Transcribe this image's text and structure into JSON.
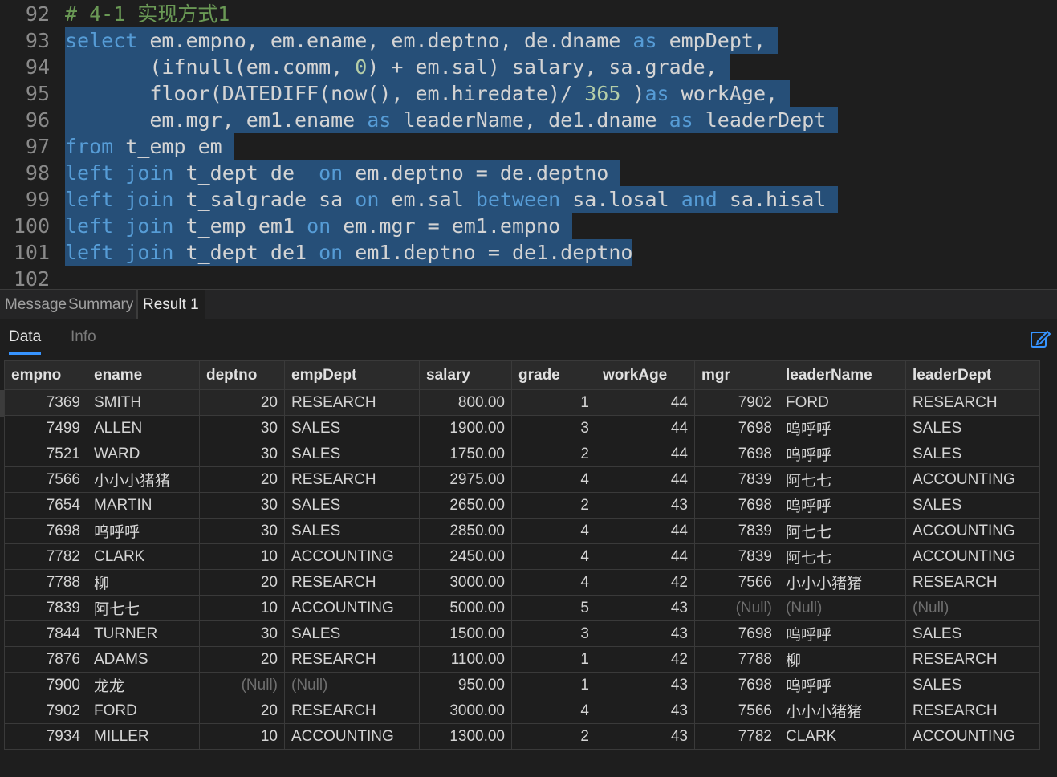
{
  "editor": {
    "lines": [
      {
        "num": "92",
        "highlight": false,
        "tokens": [
          {
            "t": "# 4-1 实现方式1",
            "c": "cmt"
          }
        ]
      },
      {
        "num": "93",
        "highlight": true,
        "tokens": [
          {
            "t": "select",
            "c": "kw"
          },
          {
            "t": " em.empno, em.ename, em.deptno, de.dname ",
            "c": "txt"
          },
          {
            "t": "as",
            "c": "kw"
          },
          {
            "t": " empDept, ",
            "c": "txt"
          }
        ]
      },
      {
        "num": "94",
        "highlight": true,
        "tokens": [
          {
            "t": "       (ifnull(em.comm, ",
            "c": "txt"
          },
          {
            "t": "0",
            "c": "num"
          },
          {
            "t": ") + em.sal) salary, sa.grade, ",
            "c": "txt"
          }
        ]
      },
      {
        "num": "95",
        "highlight": true,
        "tokens": [
          {
            "t": "       floor(DATEDIFF(now(), em.hiredate)/ ",
            "c": "txt"
          },
          {
            "t": "365",
            "c": "num"
          },
          {
            "t": " )",
            "c": "txt"
          },
          {
            "t": "as",
            "c": "kw"
          },
          {
            "t": " workAge, ",
            "c": "txt"
          }
        ]
      },
      {
        "num": "96",
        "highlight": true,
        "tokens": [
          {
            "t": "       em.mgr, em1.ename ",
            "c": "txt"
          },
          {
            "t": "as",
            "c": "kw"
          },
          {
            "t": " leaderName, de1.dname ",
            "c": "txt"
          },
          {
            "t": "as",
            "c": "kw"
          },
          {
            "t": " leaderDept ",
            "c": "txt"
          }
        ]
      },
      {
        "num": "97",
        "highlight": true,
        "tokens": [
          {
            "t": "from",
            "c": "kw"
          },
          {
            "t": " t_emp em ",
            "c": "txt"
          }
        ]
      },
      {
        "num": "98",
        "highlight": true,
        "tokens": [
          {
            "t": "left",
            "c": "kw"
          },
          {
            "t": " ",
            "c": "txt"
          },
          {
            "t": "join",
            "c": "kw"
          },
          {
            "t": " t_dept de  ",
            "c": "txt"
          },
          {
            "t": "on",
            "c": "kw"
          },
          {
            "t": " em.deptno = de.deptno ",
            "c": "txt"
          }
        ]
      },
      {
        "num": "99",
        "highlight": true,
        "tokens": [
          {
            "t": "left",
            "c": "kw"
          },
          {
            "t": " ",
            "c": "txt"
          },
          {
            "t": "join",
            "c": "kw"
          },
          {
            "t": " t_salgrade sa ",
            "c": "txt"
          },
          {
            "t": "on",
            "c": "kw"
          },
          {
            "t": " em.sal ",
            "c": "txt"
          },
          {
            "t": "between",
            "c": "kw"
          },
          {
            "t": " sa.losal ",
            "c": "txt"
          },
          {
            "t": "and",
            "c": "kw"
          },
          {
            "t": " sa.hisal ",
            "c": "txt"
          }
        ]
      },
      {
        "num": "100",
        "highlight": true,
        "tokens": [
          {
            "t": "left",
            "c": "kw"
          },
          {
            "t": " ",
            "c": "txt"
          },
          {
            "t": "join",
            "c": "kw"
          },
          {
            "t": " t_emp em1 ",
            "c": "txt"
          },
          {
            "t": "on",
            "c": "kw"
          },
          {
            "t": " em.mgr = em1.empno ",
            "c": "txt"
          }
        ]
      },
      {
        "num": "101",
        "highlight": true,
        "tokens": [
          {
            "t": "left",
            "c": "kw"
          },
          {
            "t": " ",
            "c": "txt"
          },
          {
            "t": "join",
            "c": "kw"
          },
          {
            "t": " t_dept de1 ",
            "c": "txt"
          },
          {
            "t": "on",
            "c": "kw"
          },
          {
            "t": " em1.deptno = de1.deptno",
            "c": "txt"
          }
        ]
      },
      {
        "num": "102",
        "highlight": false,
        "tokens": []
      }
    ]
  },
  "result_tabs": {
    "message": "Message",
    "summary": "Summary",
    "result1": "Result 1"
  },
  "sub_tabs": {
    "data": "Data",
    "info": "Info"
  },
  "grid": {
    "columns": [
      {
        "label": "empno",
        "align": "r"
      },
      {
        "label": "ename",
        "align": "l"
      },
      {
        "label": "deptno",
        "align": "r"
      },
      {
        "label": "empDept",
        "align": "l"
      },
      {
        "label": "salary",
        "align": "r"
      },
      {
        "label": "grade",
        "align": "r"
      },
      {
        "label": "workAge",
        "align": "r"
      },
      {
        "label": "mgr",
        "align": "r"
      },
      {
        "label": "leaderName",
        "align": "l"
      },
      {
        "label": "leaderDept",
        "align": "l"
      }
    ],
    "null_text": "(Null)",
    "rows": [
      [
        "7369",
        "SMITH",
        "20",
        "RESEARCH",
        "800.00",
        "1",
        "44",
        "7902",
        "FORD",
        "RESEARCH"
      ],
      [
        "7499",
        "ALLEN",
        "30",
        "SALES",
        "1900.00",
        "3",
        "44",
        "7698",
        "呜呼呼",
        "SALES"
      ],
      [
        "7521",
        "WARD",
        "30",
        "SALES",
        "1750.00",
        "2",
        "44",
        "7698",
        "呜呼呼",
        "SALES"
      ],
      [
        "7566",
        "小小小猪猪",
        "20",
        "RESEARCH",
        "2975.00",
        "4",
        "44",
        "7839",
        "阿七七",
        "ACCOUNTING"
      ],
      [
        "7654",
        "MARTIN",
        "30",
        "SALES",
        "2650.00",
        "2",
        "43",
        "7698",
        "呜呼呼",
        "SALES"
      ],
      [
        "7698",
        "呜呼呼",
        "30",
        "SALES",
        "2850.00",
        "4",
        "44",
        "7839",
        "阿七七",
        "ACCOUNTING"
      ],
      [
        "7782",
        "CLARK",
        "10",
        "ACCOUNTING",
        "2450.00",
        "4",
        "44",
        "7839",
        "阿七七",
        "ACCOUNTING"
      ],
      [
        "7788",
        "柳",
        "20",
        "RESEARCH",
        "3000.00",
        "4",
        "42",
        "7566",
        "小小小猪猪",
        "RESEARCH"
      ],
      [
        "7839",
        "阿七七",
        "10",
        "ACCOUNTING",
        "5000.00",
        "5",
        "43",
        null,
        null,
        null
      ],
      [
        "7844",
        "TURNER",
        "30",
        "SALES",
        "1500.00",
        "3",
        "43",
        "7698",
        "呜呼呼",
        "SALES"
      ],
      [
        "7876",
        "ADAMS",
        "20",
        "RESEARCH",
        "1100.00",
        "1",
        "42",
        "7788",
        "柳",
        "RESEARCH"
      ],
      [
        "7900",
        "龙龙",
        null,
        null,
        "950.00",
        "1",
        "43",
        "7698",
        "呜呼呼",
        "SALES"
      ],
      [
        "7902",
        "FORD",
        "20",
        "RESEARCH",
        "3000.00",
        "4",
        "43",
        "7566",
        "小小小猪猪",
        "RESEARCH"
      ],
      [
        "7934",
        "MILLER",
        "10",
        "ACCOUNTING",
        "1300.00",
        "2",
        "43",
        "7782",
        "CLARK",
        "ACCOUNTING"
      ]
    ]
  },
  "colors": {
    "selection": "#264f78",
    "keyword": "#569cd6",
    "number": "#b5cea8",
    "comment": "#6a9955",
    "active_tab_underline": "#3794ff"
  }
}
